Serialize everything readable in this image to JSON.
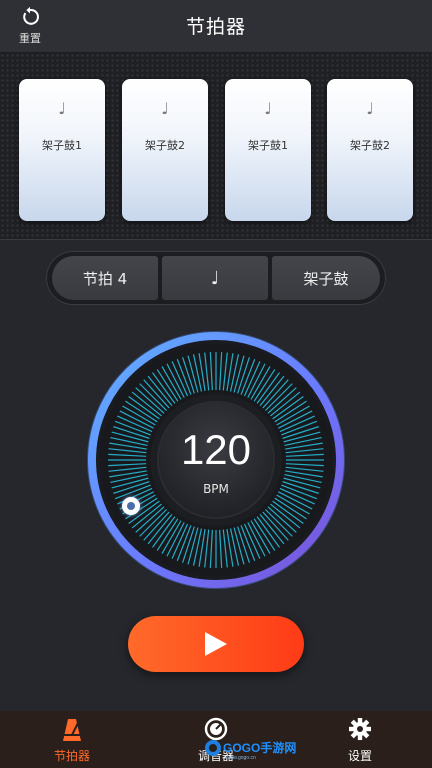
{
  "header": {
    "title": "节拍器",
    "reset_label": "重置"
  },
  "pads": [
    {
      "note": "♩",
      "label": "架子鼓1"
    },
    {
      "note": "♩",
      "label": "架子鼓2"
    },
    {
      "note": "♩",
      "label": "架子鼓1"
    },
    {
      "note": "♩",
      "label": "架子鼓2"
    }
  ],
  "controls": {
    "beat": "节拍 4",
    "note": "♩",
    "sound": "架子鼓"
  },
  "tempo": {
    "value": "120",
    "unit": "BPM"
  },
  "tabs": [
    {
      "label": "节拍器",
      "icon": "metronome-icon",
      "active": true
    },
    {
      "label": "调音器",
      "icon": "tuner-icon",
      "active": false
    },
    {
      "label": "设置",
      "icon": "gear-icon",
      "active": false
    }
  ],
  "watermark": {
    "text": "GOGO手游网",
    "sub": "www.gogo.cn"
  },
  "colors": {
    "accent": "#ff5a22",
    "ring": "#4aa0ff",
    "ticks": "#29c7e6"
  }
}
